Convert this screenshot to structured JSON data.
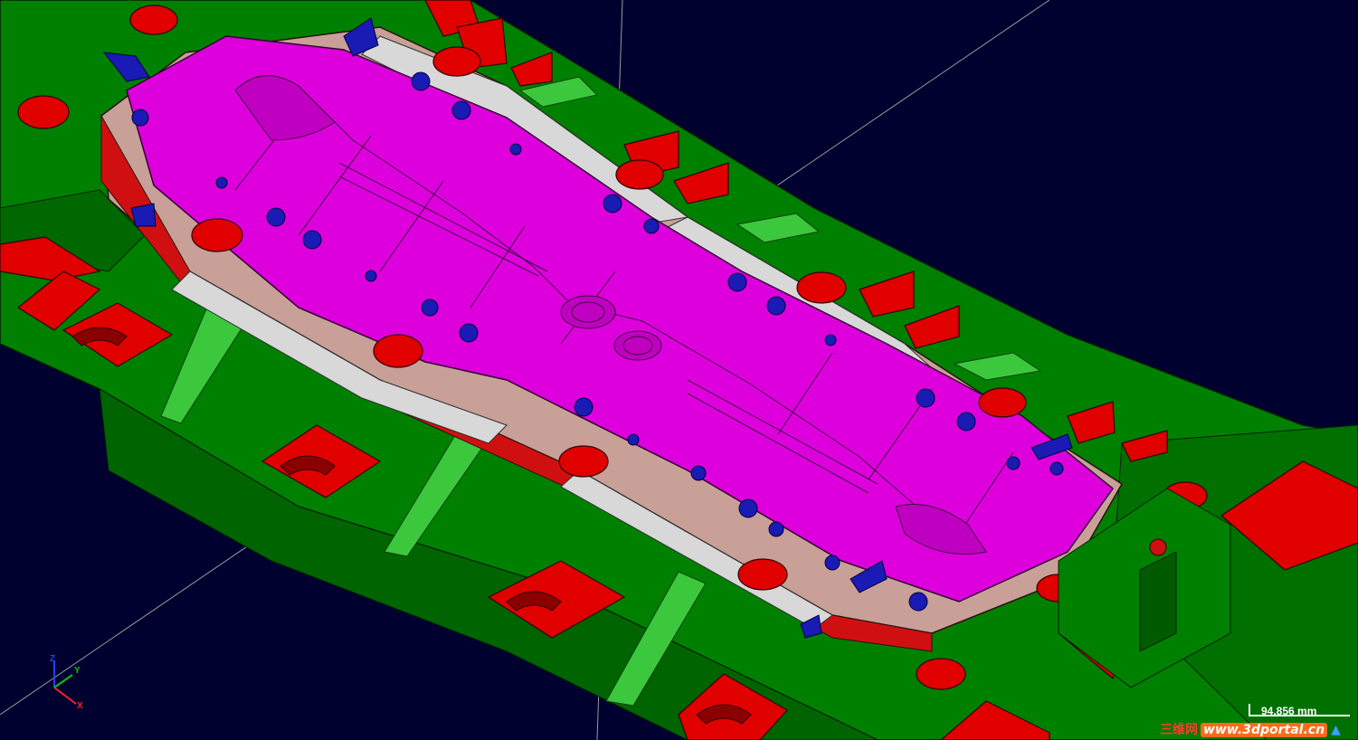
{
  "viewport": {
    "background": "#010130",
    "colors": {
      "die_base": "#008000",
      "die_base_dark": "#005a00",
      "blocks": "#e00000",
      "punch_surface": "#dd00dd",
      "holder_plate": "#c8a098",
      "keys": "#1a1ab4",
      "ribs": "#3cc83c",
      "inserts": "#d8d8d8"
    }
  },
  "triad": {
    "z_label": "Z",
    "y_label": "Y",
    "x_label": "X"
  },
  "scale": {
    "label": "94.856 mm"
  },
  "watermark": {
    "brand": "三维网",
    "url": "www.3dportal.cn",
    "icon": "tshirt-icon"
  }
}
